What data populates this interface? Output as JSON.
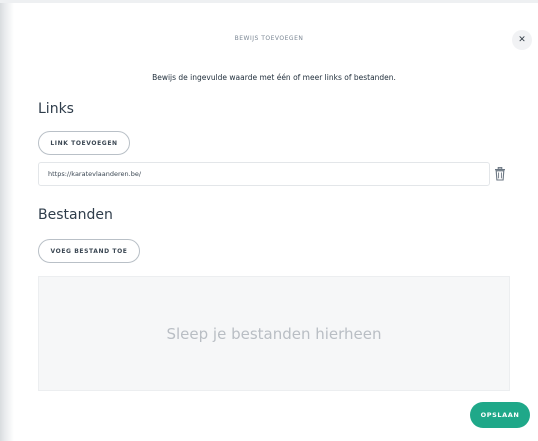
{
  "modal": {
    "title": "BEWIJS TOEVOEGEN",
    "close_icon": "close-icon",
    "intro": "Bewijs de ingevulde waarde met één of meer links of bestanden."
  },
  "links": {
    "heading": "Links",
    "add_label": "LINK TOEVOEGEN",
    "items": [
      {
        "url": "https://karatevlaanderen.be/",
        "delete_icon": "trash-icon"
      }
    ]
  },
  "files": {
    "heading": "Bestanden",
    "add_label": "VOEG BESTAND TOE",
    "dropzone_text": "Sleep je bestanden hierheen"
  },
  "footer": {
    "save_label": "OPSLAAN"
  },
  "colors": {
    "accent": "#1fa889",
    "text": "#2b3a4a",
    "dropzone_bg": "#f6f7f8"
  }
}
